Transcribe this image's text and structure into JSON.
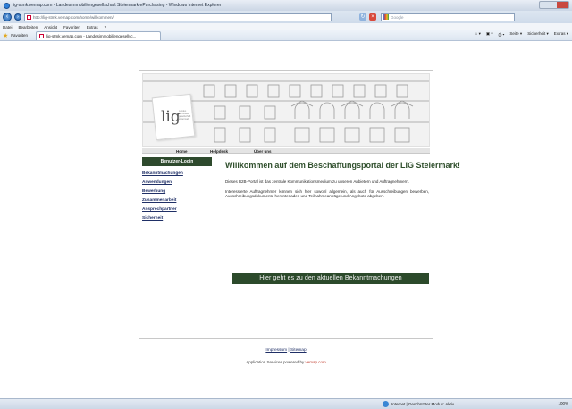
{
  "browser": {
    "window_title": "lig-stmk.vemap.com - Landesimmobiliengesellschaft Steiermark ePurchasing - Windows Internet Explorer",
    "address": "http://lig-stmk.vemap.com/home/willkommen/",
    "search_placeholder": "Google",
    "menu": [
      "Datei",
      "Bearbeiten",
      "Ansicht",
      "Favoriten",
      "Extras",
      "?"
    ],
    "favorites_label": "Favoriten",
    "tab_title": "lig-stmk.vemap.com - Landesimmobiliengesellsc...",
    "command_items": [
      "Seite ▾",
      "Sicherheit ▾",
      "Extras ▾"
    ],
    "status_zone": "Internet | Geschützter Modus: Aktiv",
    "zoom": "100%"
  },
  "site": {
    "logo_text": "lig",
    "logo_sub": "Landes immobilien gesellschaft steiermark",
    "nav": [
      "Home",
      "Helpdesk",
      "Über uns"
    ],
    "sidebar": {
      "login_label": "Benutzer-Login",
      "links": [
        "Bekanntmachungen",
        "Anwendungen",
        "Bewerbung",
        "Zusammenarbeit",
        "Ansprechpartner",
        "Sicherheit"
      ]
    },
    "headline": "Willkommen auf dem Beschaffungsportal der LIG Steiermark!",
    "paragraph1": "Dieses B2B-Portal ist das zentrale Kommunikationsmedium zu unseren Anbietern und Auftragnehmern.",
    "paragraph2": "Interessierte Auftragnehmer können sich hier sowohl allgemein, als auch für Ausschreibungen bewerben, Ausschreibungsdokumente herunterladen und Teilnahmeanträge und Angebote abgeben.",
    "cta_label": "Hier geht es zu den aktuellen Bekanntmachungen",
    "footer_impressum": "Impressum",
    "footer_sitemap": "Sitemap",
    "footer_powered_prefix": "Application Services powered by",
    "footer_powered_brand": "vemap.com"
  }
}
